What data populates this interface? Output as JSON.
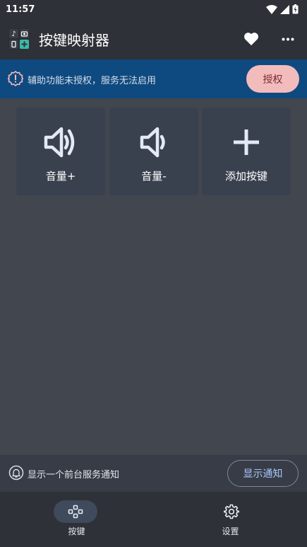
{
  "status_bar": {
    "time": "11:57"
  },
  "app_bar": {
    "title": "按键映射器"
  },
  "warning": {
    "text": "辅助功能未授权，服务无法启用",
    "button": "授权"
  },
  "keys": [
    {
      "label": "音量+",
      "icon": "volume-up-icon"
    },
    {
      "label": "音量-",
      "icon": "volume-down-icon"
    },
    {
      "label": "添加按键",
      "icon": "plus-icon"
    }
  ],
  "notification": {
    "text": "显示一个前台服务通知",
    "button": "显示通知"
  },
  "bottom_nav": {
    "items": [
      {
        "label": "按键",
        "icon": "gamepad-icon",
        "selected": true
      },
      {
        "label": "设置",
        "icon": "gear-icon",
        "selected": false
      }
    ]
  },
  "colors": {
    "background": "#42464f",
    "bar": "#2e3137",
    "warning_bar": "#0e4a80",
    "auth_button": "#f3bcbc",
    "card": "#3a414e",
    "accent_text": "#a8c8ff"
  }
}
